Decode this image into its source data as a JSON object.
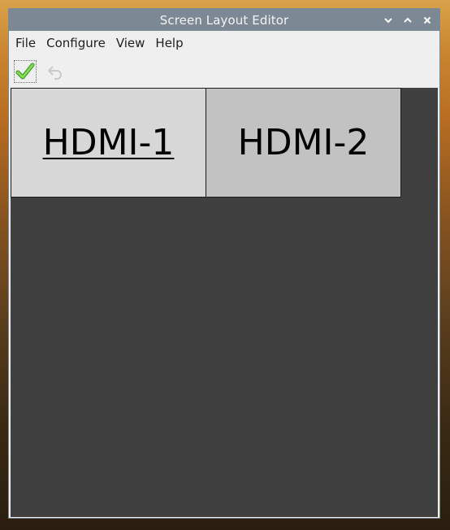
{
  "window": {
    "title": "Screen Layout Editor"
  },
  "menu": {
    "items": [
      "File",
      "Configure",
      "View",
      "Help"
    ]
  },
  "toolbar": {
    "apply_icon": "checkmark-icon",
    "undo_icon": "undo-icon"
  },
  "displays": [
    {
      "label": "HDMI-1",
      "selected": true
    },
    {
      "label": "HDMI-2",
      "selected": false
    }
  ],
  "colors": {
    "titlebar": "#7c8893",
    "canvas": "#404040",
    "display_selected": "#d7d7d7",
    "display_normal": "#c2c2c2",
    "apply_green": "#5cc43a"
  }
}
